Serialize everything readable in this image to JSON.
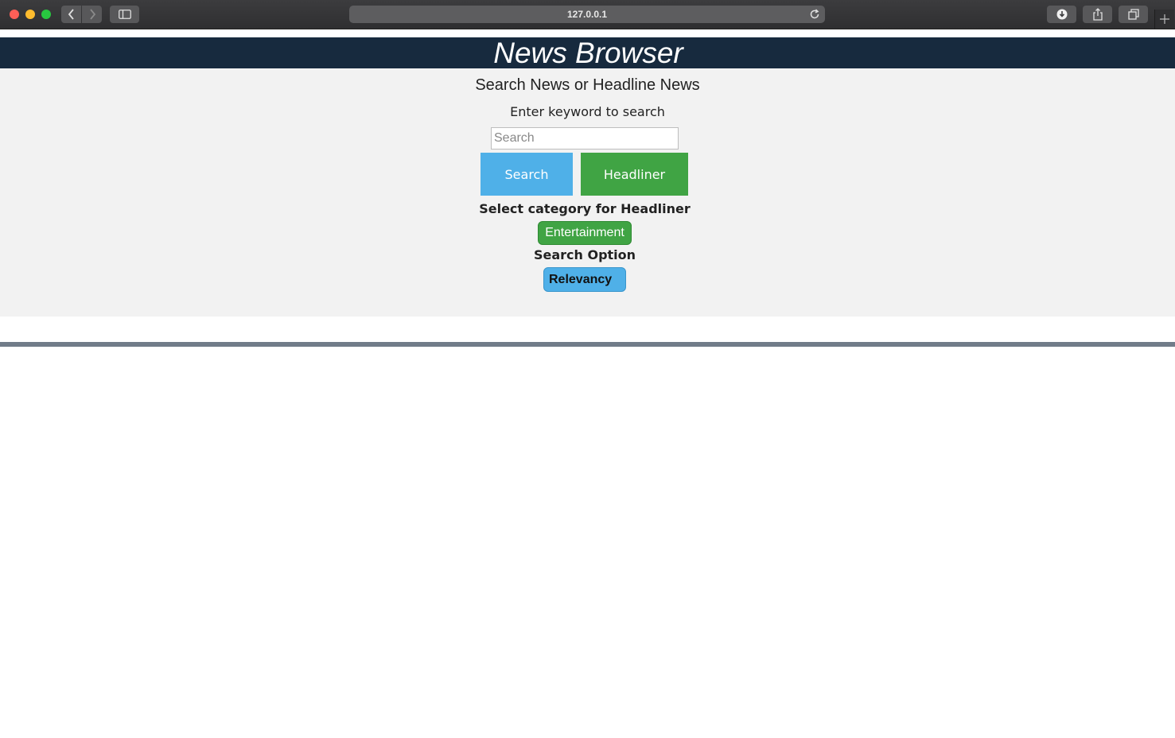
{
  "browser": {
    "address": "127.0.0.1"
  },
  "header": {
    "title": "News Browser"
  },
  "search_panel": {
    "heading": "Search News or Headline News",
    "keyword_label": "Enter keyword to search",
    "search_input": {
      "placeholder": "Search",
      "value": ""
    },
    "search_button_label": "Search",
    "headliner_button_label": "Headliner",
    "category_label": "Select category for Headliner",
    "category_selected": "Entertainment",
    "option_label": "Search Option",
    "option_selected": "Relevancy"
  },
  "colors": {
    "header_bg": "#172a3e",
    "search_blue": "#4fb0e8",
    "headliner_green": "#40a444",
    "panel_bg": "#f2f2f2",
    "divider": "#717c89"
  }
}
